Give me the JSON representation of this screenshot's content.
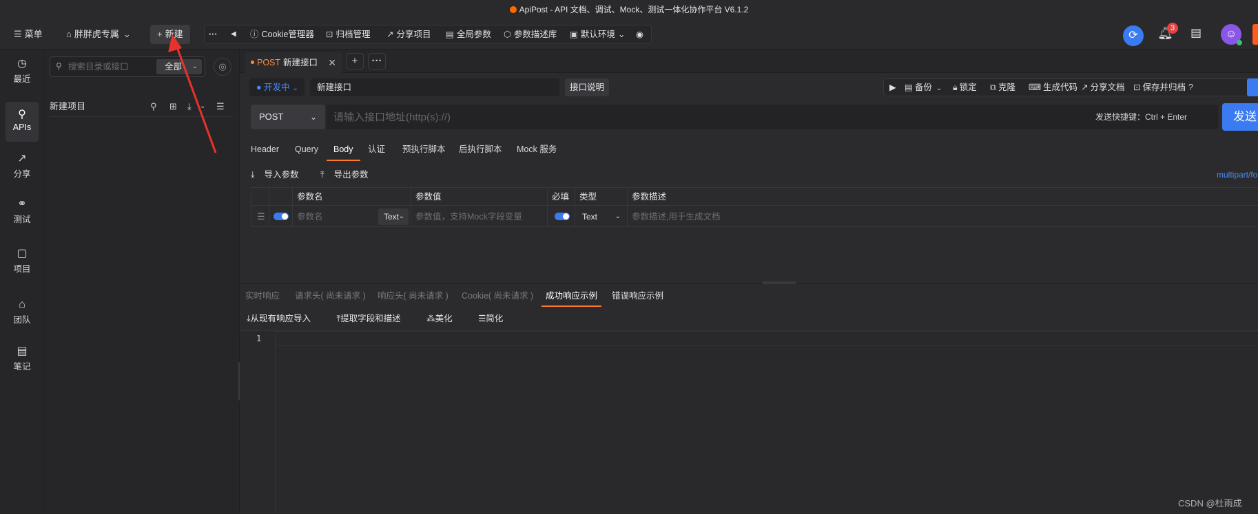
{
  "window": {
    "title": "ApiPost - API 文档、调试、Mock、测试一体化协作平台 V6.1.2"
  },
  "topbar": {
    "menu_label": "菜单",
    "workspace": "胖胖虎专属",
    "new_label": "新建",
    "more": "···",
    "collapse": "◀",
    "tools": [
      "Cookie管理器",
      "归档管理",
      "分享项目",
      "全局参数",
      "参数描述库",
      "默认环境"
    ],
    "notification_count": "3"
  },
  "leftnav": {
    "items": [
      "最近",
      "APIs",
      "分享",
      "测试",
      "项目",
      "团队",
      "笔记"
    ]
  },
  "sidebar": {
    "search_placeholder": "搜索目录或接口",
    "scope": "全部",
    "project_name": "新建项目"
  },
  "tabs": {
    "method": "POST",
    "title": "新建接口"
  },
  "request": {
    "status": "开发中",
    "name": "新建接口",
    "desc_button": "接口说明",
    "actions": [
      "备份",
      "锁定",
      "克隆",
      "生成代码",
      "分享文档",
      "保存并归档"
    ],
    "method": "POST",
    "url_placeholder": "请输入接口地址(http(s)://)",
    "shortcut_hint": "发送快捷键：Ctrl + Enter",
    "send": "发送"
  },
  "req_tabs": [
    "Header",
    "Query",
    "Body",
    "认证",
    "预执行脚本",
    "后执行脚本",
    "Mock 服务"
  ],
  "param_tools": {
    "import": "导入参数",
    "export": "导出参数",
    "content_type": "multipart/fo"
  },
  "param_table": {
    "headers": [
      "参数名",
      "参数值",
      "必填",
      "类型",
      "参数描述"
    ],
    "row": {
      "name_placeholder": "参数名",
      "name_type": "Text",
      "value_placeholder": "参数值，支持Mock字段变量",
      "type": "Text",
      "desc_placeholder": "参数描述,用于生成文档"
    }
  },
  "resp_tabs": [
    "实时响应",
    "请求头( 尚未请求 )",
    "响应头( 尚未请求 )",
    "Cookie( 尚未请求 )",
    "成功响应示例",
    "错误响应示例"
  ],
  "resp_tools": [
    "从现有响应导入",
    "提取字段和描述",
    "美化",
    "简化"
  ],
  "editor": {
    "line": "1"
  },
  "watermark": "CSDN @杜雨成",
  "colors": {
    "accent": "#3a7bf2",
    "brand": "#ff6a00",
    "active_underline": "#ff7a2d",
    "annotation_arrow": "#e8322a"
  }
}
